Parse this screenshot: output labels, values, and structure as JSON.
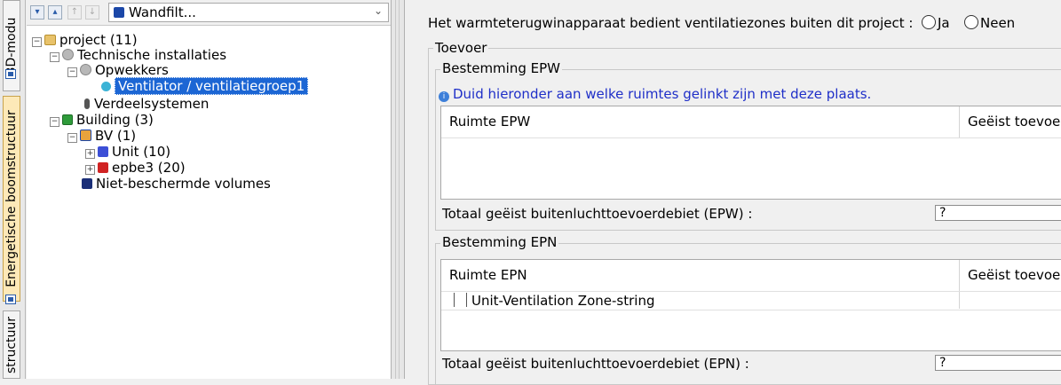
{
  "side_tabs": [
    {
      "label": "3D-modu"
    },
    {
      "label": "Energetische boomstructuur"
    },
    {
      "label": "structuur"
    }
  ],
  "toolbar": {
    "selected_view": "Wandfilt..."
  },
  "tree": {
    "project": "project (11)",
    "technische_installaties": "Technische installaties",
    "opwekkers": "Opwekkers",
    "ventilator": "Ventilator / ventilatiegroep1",
    "verdeelsystemen": "Verdeelsystemen",
    "building": "Building (3)",
    "bv": "BV (1)",
    "unit": "Unit (10)",
    "epbe3": "epbe3 (20)",
    "niet_beschermde": "Niet-beschermde volumes"
  },
  "form": {
    "question": "Het warmteterugwinapparaat bedient ventilatiezones buiten dit project :",
    "option_yes": "Ja",
    "option_no": "Neen",
    "toevoer_title": "Toevoer",
    "epw": {
      "title": "Bestemming EPW",
      "info": "Duid hieronder aan welke ruimtes gelinkt zijn met deze plaats.",
      "col_ruimte": "Ruimte EPW",
      "col_geeist": "Geëist toevoe",
      "total_label": "Totaal geëist buitenluchttoevoerdebiet (EPW) :",
      "total_value": "?"
    },
    "epn": {
      "title": "Bestemming EPN",
      "col_ruimte": "Ruimte EPN",
      "col_geeist": "Geëist toevoe",
      "rows": [
        {
          "name": "Unit-Ventilation Zone-string",
          "value": ""
        }
      ],
      "total_label": "Totaal geëist buitenluchttoevoerdebiet (EPN) :",
      "total_value": "?"
    }
  }
}
